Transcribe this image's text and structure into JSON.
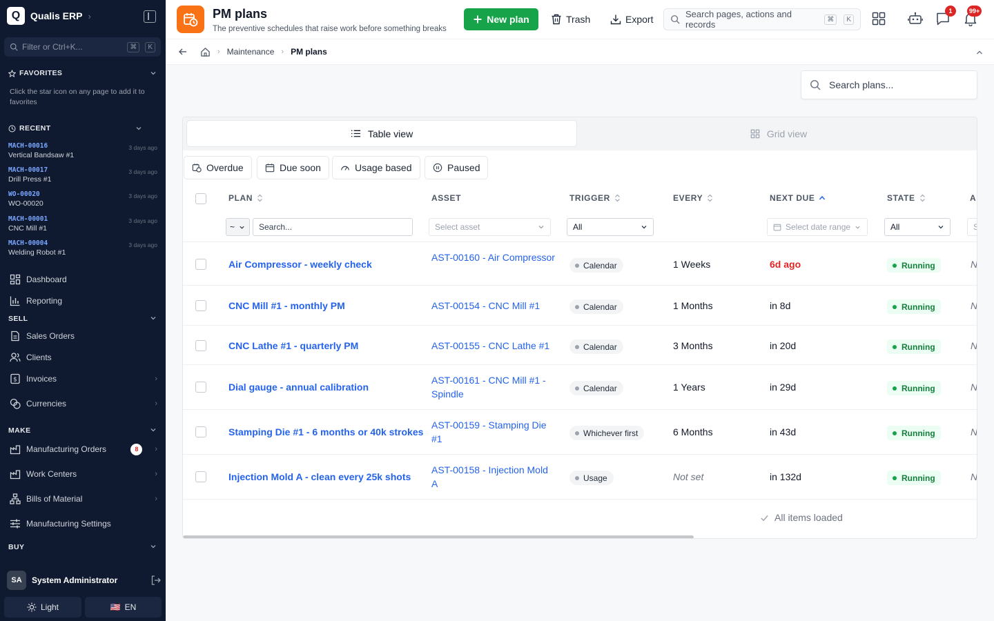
{
  "sidebar": {
    "brand_letter": "Q",
    "brand_name": "Qualis ERP",
    "filter_placeholder": "Filter or Ctrl+K...",
    "filter_kbd": [
      "⌘",
      "K"
    ],
    "favorites_title": "FAVORITES",
    "favorites_hint": "Click the star icon on any page to add it to favorites",
    "recent_title": "RECENT",
    "recent": [
      {
        "code": "MACH-00016",
        "name": "Vertical Bandsaw #1",
        "time": "3 days ago"
      },
      {
        "code": "MACH-00017",
        "name": "Drill Press #1",
        "time": "3 days ago"
      },
      {
        "code": "WO-00020",
        "name": "WO-00020",
        "time": "3 days ago"
      },
      {
        "code": "MACH-00001",
        "name": "CNC Mill #1",
        "time": "3 days ago"
      },
      {
        "code": "MACH-00004",
        "name": "Welding Robot #1",
        "time": "3 days ago"
      }
    ],
    "nav": {
      "dashboard": "Dashboard",
      "reporting": "Reporting",
      "sell_title": "SELL",
      "sales_orders": "Sales Orders",
      "clients": "Clients",
      "invoices": "Invoices",
      "currencies": "Currencies",
      "make_title": "MAKE",
      "manufacturing_orders": "Manufacturing Orders",
      "manufacturing_orders_badge": "8",
      "work_centers": "Work Centers",
      "bills_of_material": "Bills of Material",
      "manufacturing_settings": "Manufacturing Settings",
      "buy_title": "BUY"
    },
    "user_initials": "SA",
    "user_name": "System Administrator",
    "theme_label": "Light",
    "language_label": "EN",
    "language_flag": "🇺🇸"
  },
  "header": {
    "title": "PM plans",
    "subtitle": "The preventive schedules that raise work before something breaks",
    "new_plan_label": "New plan",
    "trash_label": "Trash",
    "export_label": "Export",
    "search_placeholder": "Search pages, actions and records",
    "search_kbd": [
      "⌘",
      "K"
    ],
    "messages_badge": "1",
    "notifications_badge": "99+"
  },
  "breadcrumb": {
    "items": [
      "Maintenance",
      "PM plans"
    ]
  },
  "plans_search_placeholder": "Search plans...",
  "view_tabs": {
    "table": "Table view",
    "grid": "Grid view"
  },
  "filter_chips": [
    "Overdue",
    "Due soon",
    "Usage based",
    "Paused"
  ],
  "table": {
    "columns": [
      "PLAN",
      "ASSET",
      "TRIGGER",
      "EVERY",
      "NEXT DUE",
      "STATE",
      "A"
    ],
    "filters": {
      "plan_operator": "~",
      "plan_placeholder": "Search...",
      "asset_placeholder": "Select asset",
      "trigger_value": "All",
      "date_placeholder": "Select date range",
      "state_value": "All",
      "last_placeholder": "S"
    },
    "rows": [
      {
        "plan": "Air Compressor - weekly check",
        "asset": "AST-00160 - Air Compressor",
        "trigger": "Calendar",
        "every": "1 Weeks",
        "next_due": "6d ago",
        "state": "Running",
        "extra": "N"
      },
      {
        "plan": "CNC Mill #1 - monthly PM",
        "asset": "AST-00154 - CNC Mill #1",
        "trigger": "Calendar",
        "every": "1 Months",
        "next_due": "in 8d",
        "state": "Running",
        "extra": "N"
      },
      {
        "plan": "CNC Lathe #1 - quarterly PM",
        "asset": "AST-00155 - CNC Lathe #1",
        "trigger": "Calendar",
        "every": "3 Months",
        "next_due": "in 20d",
        "state": "Running",
        "extra": "N"
      },
      {
        "plan": "Dial gauge - annual calibration",
        "asset": "AST-00161 - CNC Mill #1 - Spindle",
        "trigger": "Calendar",
        "every": "1 Years",
        "next_due": "in 29d",
        "state": "Running",
        "extra": "N"
      },
      {
        "plan": "Stamping Die #1 - 6 months or 40k strokes",
        "asset": "AST-00159 - Stamping Die #1",
        "trigger": "Whichever first",
        "every": "6 Months",
        "next_due": "in 43d",
        "state": "Running",
        "extra": "N"
      },
      {
        "plan": "Injection Mold A - clean every 25k shots",
        "asset": "AST-00158 - Injection Mold A",
        "trigger": "Usage",
        "every": "Not set",
        "next_due": "in 132d",
        "state": "Running",
        "extra": "N"
      }
    ],
    "footer": "All items loaded"
  },
  "colors": {
    "sidebar_bg": "#0f1a30",
    "accent_green": "#16a34a",
    "link_blue": "#2563eb",
    "overdue_red": "#dc2626",
    "page_icon_orange": "#f97316"
  }
}
